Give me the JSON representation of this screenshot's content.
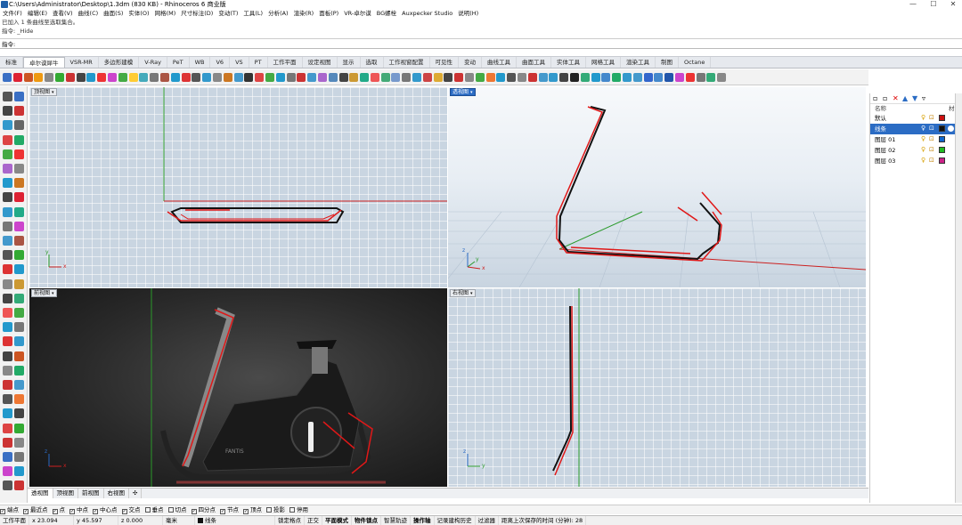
{
  "window": {
    "title": "C:\\Users\\Administrator\\Desktop\\1.3dm (830 KB) - Rhinoceros 6 商业版",
    "controls": [
      "—",
      "☐",
      "✕"
    ]
  },
  "menu": [
    "文件(F)",
    "编辑(E)",
    "查看(V)",
    "曲线(C)",
    "曲面(S)",
    "实体(O)",
    "网格(M)",
    "尺寸标注(D)",
    "变动(T)",
    "工具(L)",
    "分析(A)",
    "渲染(R)",
    "面板(P)",
    "VR-卓尔谟",
    "BG螺栓",
    "Auxpecker Studio",
    "说明(H)"
  ],
  "command_history": [
    "已加入 1 条曲线至选取集合。",
    "指令: _Hide"
  ],
  "prompt": "指令:",
  "tabs": [
    "标准",
    "卓尔谟犀牛",
    "VSR-MR",
    "多边形建模",
    "V-Ray",
    "PeT",
    "WB",
    "V6",
    "VS",
    "PT",
    "工作平面",
    "设定视图",
    "显示",
    "选取",
    "工作视窗配置",
    "可见性",
    "变动",
    "曲线工具",
    "曲面工具",
    "实体工具",
    "网格工具",
    "渲染工具",
    "制图",
    "Octane"
  ],
  "active_tab": "卓尔谟犀牛",
  "viewports": {
    "top": {
      "label": "顶视图",
      "axes": {
        "y": "y",
        "x": "x"
      }
    },
    "perspective": {
      "label": "透视图",
      "axes": {
        "z": "z",
        "y": "y",
        "x": "x"
      }
    },
    "front": {
      "label": "前视图",
      "axes": {
        "z": "z",
        "x": "x"
      },
      "render_text": "FANTIS"
    },
    "right": {
      "label": "右视图",
      "axes": {
        "z": "z",
        "y": "y"
      }
    }
  },
  "layers_panel": {
    "header": {
      "name": "名称",
      "material": "材"
    },
    "rows": [
      {
        "name": "默认",
        "color": "#cc1111",
        "selected": false
      },
      {
        "name": "线条",
        "color": "#111111",
        "selected": true
      },
      {
        "name": "图层 01",
        "color": "#1166cc",
        "selected": false
      },
      {
        "name": "图层 02",
        "color": "#22bb22",
        "selected": false
      },
      {
        "name": "图层 03",
        "color": "#cc2288",
        "selected": false
      }
    ]
  },
  "viewport_tabs": [
    "透视图",
    "顶视图",
    "前视图",
    "右视图",
    "✣"
  ],
  "active_viewport_tab": "透视图",
  "osnaps": [
    {
      "label": "端点",
      "checked": true
    },
    {
      "label": "最近点",
      "checked": true
    },
    {
      "label": "点",
      "checked": true
    },
    {
      "label": "中点",
      "checked": true
    },
    {
      "label": "中心点",
      "checked": true
    },
    {
      "label": "交点",
      "checked": true
    },
    {
      "label": "垂点",
      "checked": false
    },
    {
      "label": "切点",
      "checked": false
    },
    {
      "label": "四分点",
      "checked": true
    },
    {
      "label": "节点",
      "checked": true
    },
    {
      "label": "顶点",
      "checked": true
    },
    {
      "label": "投影",
      "checked": false
    },
    {
      "label": "停用",
      "checked": false
    }
  ],
  "status": {
    "plane": "工作平面",
    "x": "x 23.094",
    "y": "y 45.597",
    "z": "z 0.000",
    "units": "毫米",
    "layer": "线条",
    "items": [
      "锁定格点",
      "正交",
      "平面模式",
      "物件锁点",
      "智慧轨迹",
      "操作轴",
      "记录建构历史",
      "过滤器",
      "距离上次保存的时间 (分钟): 28"
    ]
  },
  "colors": {
    "curve_red": "#e01818",
    "curve_black": "#111111",
    "axis_green": "#2a9a2a",
    "axis_red": "#cc2020",
    "active_blue": "#2b6cc4"
  }
}
